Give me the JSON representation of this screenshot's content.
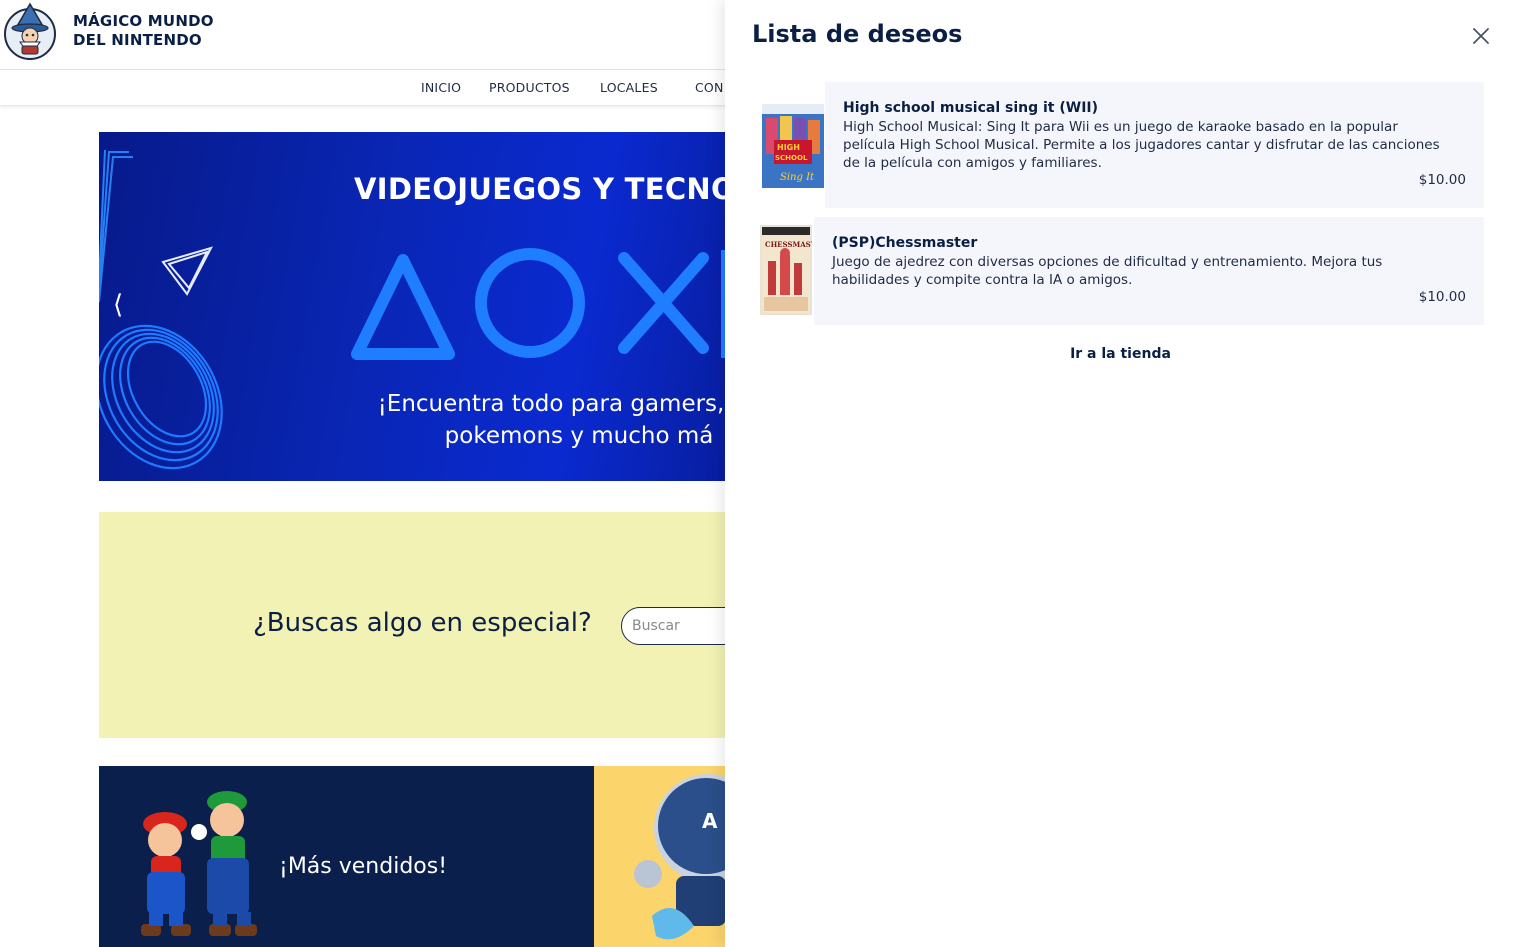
{
  "header": {
    "brand_line1": "MÁGICO MUNDO",
    "brand_line2": "DEL NINTENDO",
    "logo": "wizard-mascot-logo"
  },
  "nav": {
    "items": [
      "INICIO",
      "PRODUCTOS",
      "LOCALES",
      "CON"
    ]
  },
  "hero": {
    "title": "VIDEOJUEGOS Y TECNO",
    "subtitle": "¡Encuentra todo para gamers, fans\npokemons y mucho má",
    "prev_icon": "chevron-left-icon"
  },
  "search": {
    "title": "¿Buscas algo en especial?",
    "placeholder": "Buscar",
    "value": ""
  },
  "cards": {
    "best_sellers_label": "¡Más vendidos!"
  },
  "wishlist": {
    "title": "Lista de deseos",
    "close_icon": "close-icon",
    "items": [
      {
        "name": "High school musical sing it (WII)",
        "description": "High School Musical: Sing It para Wii es un juego de karaoke basado en la popular película High School Musical. Permite a los jugadores cantar y disfrutar de las canciones de la película con amigos y familiares.",
        "price": "$10.00"
      },
      {
        "name": "(PSP)Chessmaster",
        "description": "Juego de ajedrez con diversas opciones de dificultad y entrenamiento. Mejora tus habilidades y compite contra la IA o amigos.",
        "price": "$10.00"
      }
    ],
    "store_link": "Ir a la tienda"
  },
  "colors": {
    "navy": "#0b1f45",
    "hero_blue": "#0926b5",
    "search_band": "#f1f2b4",
    "funko_yellow": "#fbd46c",
    "wish_item_bg": "#f5f6fb"
  }
}
